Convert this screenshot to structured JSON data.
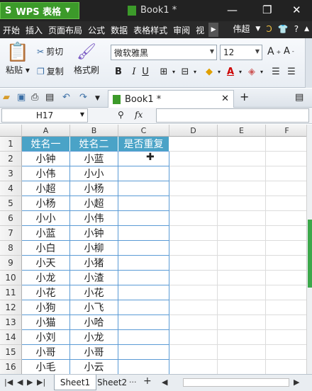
{
  "titlebar": {
    "app_label": "WPS 表格",
    "app_logo": "S",
    "doc_title": "Book1 *"
  },
  "menubar": {
    "items": [
      "开始",
      "插入",
      "页面布局",
      "公式",
      "数据",
      "表格样式",
      "审阅",
      "视"
    ],
    "user": "伟超"
  },
  "ribbon": {
    "paste": "粘贴",
    "cut": "剪切",
    "copy": "复制",
    "format_painter": "格式刷",
    "font_name": "微软雅黑",
    "font_size": "12",
    "bold": "B",
    "italic": "I",
    "underline": "U"
  },
  "tabbar": {
    "doc_tab": "Book1 *",
    "add_tab": "+"
  },
  "formulabar": {
    "name_box": "H17",
    "fx": "fx",
    "value": ""
  },
  "grid": {
    "columns": [
      "A",
      "B",
      "C",
      "D",
      "E",
      "F"
    ],
    "rows": [
      "1",
      "2",
      "3",
      "4",
      "5",
      "6",
      "7",
      "8",
      "9",
      "10",
      "11",
      "12",
      "13",
      "14",
      "15",
      "16"
    ],
    "header_row": [
      "姓名一",
      "姓名二",
      "是否重复"
    ],
    "col_a": [
      "小钟",
      "小伟",
      "小超",
      "小杨",
      "小小",
      "小蓝",
      "小白",
      "小天",
      "小龙",
      "小花",
      "小狗",
      "小猫",
      "小刘",
      "小哥",
      "小毛"
    ],
    "col_b": [
      "小蓝",
      "小小",
      "小杨",
      "小超",
      "小伟",
      "小钟",
      "小柳",
      "小猪",
      "小渣",
      "小花",
      "小飞",
      "小哈",
      "小龙",
      "小哥",
      "小云"
    ]
  },
  "sheets": {
    "tabs": [
      "Sheet1",
      "Sheet2"
    ],
    "active": "Sheet1"
  },
  "colors": {
    "header_fill": "#4aa3c7",
    "table_border": "#5b9bd5",
    "app_green": "#3c9a2a"
  }
}
